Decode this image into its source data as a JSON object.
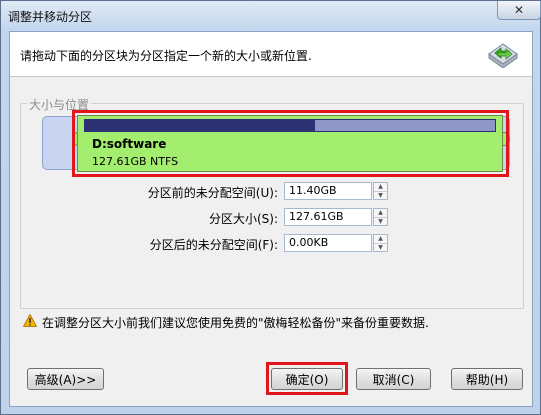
{
  "window": {
    "title": "调整并移动分区",
    "close_glyph": "✕"
  },
  "header": {
    "instruction": "请拖动下面的分区块为分区指定一个新的大小或新位置.",
    "icon": "move-resize-arrows-icon"
  },
  "group": {
    "label": "大小与位置"
  },
  "partition": {
    "name": "D:software",
    "info": "127.61GB NTFS",
    "used_fraction": 0.56,
    "color": "#a3ee6e",
    "used_color": "#2b3173"
  },
  "fields": {
    "before_label": "分区前的未分配空间(U):",
    "before_value": "11.40GB",
    "size_label": "分区大小(S):",
    "size_value": "127.61GB",
    "after_label": "分区后的未分配空间(F):",
    "after_value": "0.00KB"
  },
  "warning": {
    "text": "在调整分区大小前我们建议您使用免费的\"傲梅轻松备份\"来备份重要数据."
  },
  "buttons": {
    "advanced": "高级(A)>>",
    "ok": "确定(O)",
    "cancel": "取消(C)",
    "help": "帮助(H)"
  },
  "colors": {
    "highlight": "#e0161b",
    "window_frame": "#bcd0ea"
  }
}
